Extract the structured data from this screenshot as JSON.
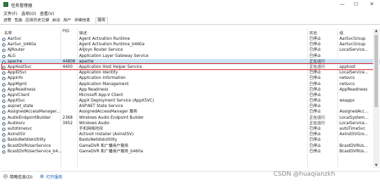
{
  "window": {
    "title": "任务管理器",
    "min": "—",
    "max": "☐",
    "close": "✕"
  },
  "menu": [
    "文件(F)",
    "选项(O)",
    "查看(V)"
  ],
  "tabs": [
    "进程",
    "性能",
    "应用历史记录",
    "启动",
    "用户",
    "详细信息",
    "服务"
  ],
  "active_tab": 6,
  "columns": [
    "名称",
    "PID",
    "描述",
    "状态",
    "组"
  ],
  "rows": [
    {
      "name": "AarSvc",
      "pid": "",
      "desc": "Agent Activation Runtime",
      "status": "已停止",
      "group": "AarSvcGroup"
    },
    {
      "name": "AarSvc_b460a",
      "pid": "",
      "desc": "Agent Activation Runtime_b460a",
      "status": "已停止",
      "group": "AarSvcGroup"
    },
    {
      "name": "AJRouter",
      "pid": "",
      "desc": "AllJoyn Router Service",
      "status": "已停止",
      "group": "LocalService..."
    },
    {
      "name": "ALG",
      "pid": "",
      "desc": "Application Layer Gateway Service",
      "status": "已停止",
      "group": ""
    },
    {
      "name": "apache",
      "pid": "44808",
      "desc": "apache",
      "status": "正在运行",
      "group": ""
    },
    {
      "name": "AppHostSvc",
      "pid": "4400",
      "desc": "Application Host Helper Service",
      "status": "正在运行",
      "group": "apphost"
    },
    {
      "name": "AppIDSvc",
      "pid": "",
      "desc": "Application Identity",
      "status": "已停止",
      "group": "LocalService..."
    },
    {
      "name": "Appinfo",
      "pid": "",
      "desc": "Application Information",
      "status": "已停止",
      "group": "netsvcs"
    },
    {
      "name": "AppMgmt",
      "pid": "",
      "desc": "Application Management",
      "status": "已停止",
      "group": "netsvcs"
    },
    {
      "name": "AppReadiness",
      "pid": "",
      "desc": "App Readiness",
      "status": "已停止",
      "group": "AppReadiness"
    },
    {
      "name": "AppVClient",
      "pid": "",
      "desc": "Microsoft App-V Client",
      "status": "已停止",
      "group": ""
    },
    {
      "name": "AppXSvc",
      "pid": "",
      "desc": "AppX Deployment Service (AppXSVC)",
      "status": "已停止",
      "group": "wsappx"
    },
    {
      "name": "aspnet_state",
      "pid": "",
      "desc": "ASP.NET State Service",
      "status": "已停止",
      "group": ""
    },
    {
      "name": "AssignedAccessManager...",
      "pid": "",
      "desc": "AssignedAccessManager 服务",
      "status": "已停止",
      "group": "AssignedAcc..."
    },
    {
      "name": "AudioEndpointBuilder",
      "pid": "2368",
      "desc": "Windows Audio Endpoint Builder",
      "status": "正在运行",
      "group": "LocalSystem..."
    },
    {
      "name": "Audiosrv",
      "pid": "3952",
      "desc": "Windows Audio",
      "status": "正在运行",
      "group": "LocalService..."
    },
    {
      "name": "autotimesvc",
      "pid": "",
      "desc": "手机网络时间",
      "status": "已停止",
      "group": "autoTimeSvc"
    },
    {
      "name": "AxInstSV",
      "pid": "",
      "desc": "ActiveX Installer (AxInstSV)",
      "status": "已停止",
      "group": "AxInstSVGro..."
    },
    {
      "name": "BaiduNetdiskUtility",
      "pid": "",
      "desc": "BaiduNetdiskUtility",
      "status": "已停止",
      "group": ""
    },
    {
      "name": "BcastDVRUserService",
      "pid": "",
      "desc": "GameDVR 和广播用户服务",
      "status": "已停止",
      "group": "BcastDVRUs..."
    },
    {
      "name": "BcastDVRUserService_b4...",
      "pid": "",
      "desc": "GameDVR 和广播用户服务_b460a",
      "status": "已停止",
      "group": "BcastDVRUs..."
    }
  ],
  "selected_row": 4,
  "footer": {
    "brief": "简略信息(D)",
    "open_services": "打开服务"
  },
  "watermark": "CSDN @huaqianzkh"
}
